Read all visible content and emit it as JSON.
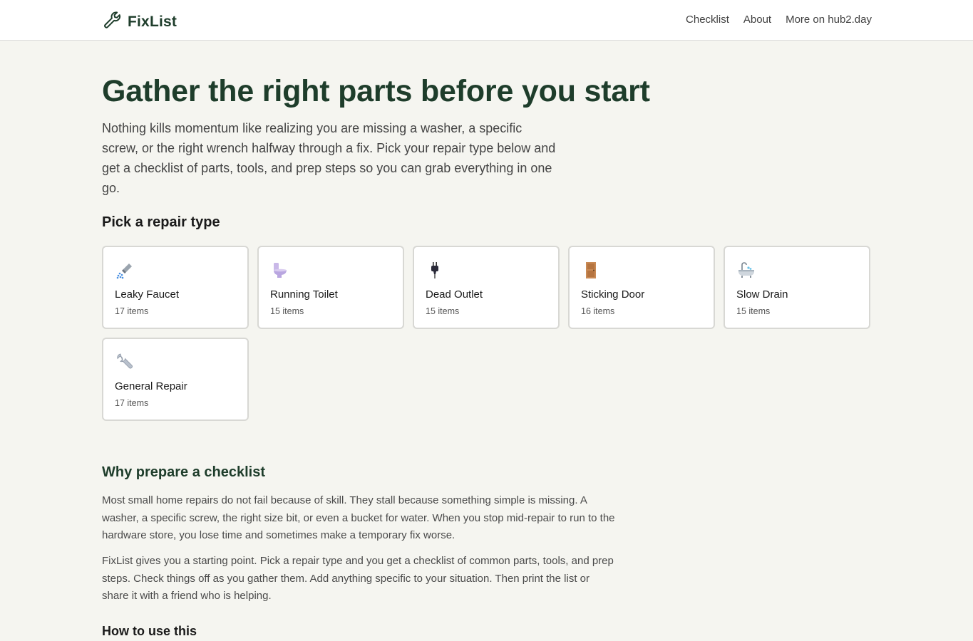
{
  "header": {
    "brand": "FixList",
    "brand_icon": "wrench-icon",
    "brand_color": "#1e3d2b",
    "nav": [
      {
        "label": "Checklist"
      },
      {
        "label": "About"
      },
      {
        "label": "More on hub2.day"
      }
    ]
  },
  "hero": {
    "title": "Gather the right parts before you start",
    "subtitle": "Nothing kills momentum like realizing you are missing a washer, a specific screw, or the right wrench halfway through a fix. Pick your repair type below and get a checklist of parts, tools, and prep steps so you can grab everything in one go."
  },
  "repair_types": {
    "heading": "Pick a repair type",
    "items": [
      {
        "name": "Leaky Faucet",
        "count": "17 items",
        "icon": "shower-icon"
      },
      {
        "name": "Running Toilet",
        "count": "15 items",
        "icon": "toilet-icon"
      },
      {
        "name": "Dead Outlet",
        "count": "15 items",
        "icon": "plug-icon"
      },
      {
        "name": "Sticking Door",
        "count": "16 items",
        "icon": "door-icon"
      },
      {
        "name": "Slow Drain",
        "count": "15 items",
        "icon": "bathtub-icon"
      },
      {
        "name": "General Repair",
        "count": "17 items",
        "icon": "wrench-icon"
      }
    ]
  },
  "why": {
    "heading": "Why prepare a checklist",
    "p1": "Most small home repairs do not fail because of skill. They stall because something simple is missing. A washer, a specific screw, the right size bit, or even a bucket for water. When you stop mid-repair to run to the hardware store, you lose time and sometimes make a temporary fix worse.",
    "p2": "FixList gives you a starting point. Pick a repair type and you get a checklist of common parts, tools, and prep steps. Check things off as you gather them. Add anything specific to your situation. Then print the list or share it with a friend who is helping."
  },
  "how": {
    "heading": "How to use this"
  }
}
